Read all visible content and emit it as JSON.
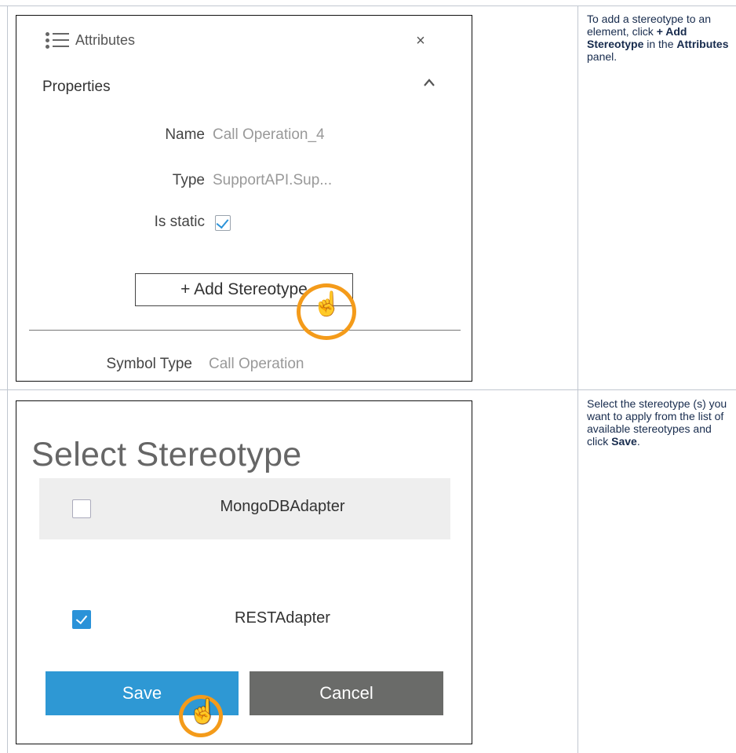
{
  "step1": {
    "panel": {
      "title": "Attributes",
      "close_glyph": "×",
      "section_title": "Properties",
      "properties": [
        {
          "label": "Name",
          "value": "Call Operation_4"
        },
        {
          "label": "Type",
          "value": "SupportAPI.Sup..."
        },
        {
          "label": "Is static",
          "checked": true
        }
      ],
      "add_stereotype_label": "+ Add Stereotype",
      "symbol_type_label": "Symbol Type",
      "symbol_type_value": "Call Operation"
    },
    "instruction": {
      "part1": "To add a stereotype to an element, click ",
      "bold1": "+ Add Stereotype",
      "part2": " in the ",
      "bold2": "Attributes",
      "part3": " panel."
    }
  },
  "step2": {
    "dialog": {
      "title": "Select Stereotype",
      "options": [
        {
          "label": "MongoDBAdapter",
          "checked": false
        },
        {
          "label": "RESTAdapter",
          "checked": true
        }
      ],
      "save_label": "Save",
      "cancel_label": "Cancel"
    },
    "instruction": {
      "part1": "Select the stereotype (s) you want to apply from the list of available stereotypes and click ",
      "bold1": "Save",
      "part2": "."
    }
  },
  "colors": {
    "accent": "#2e98d4",
    "cancel": "#6a6b69",
    "highlight": "#f49b1a",
    "grid": "#c1c7d0"
  },
  "icons": [
    "list-icon",
    "close-icon",
    "chevron-up-icon",
    "checkmark-icon",
    "hand-pointer-icon"
  ]
}
